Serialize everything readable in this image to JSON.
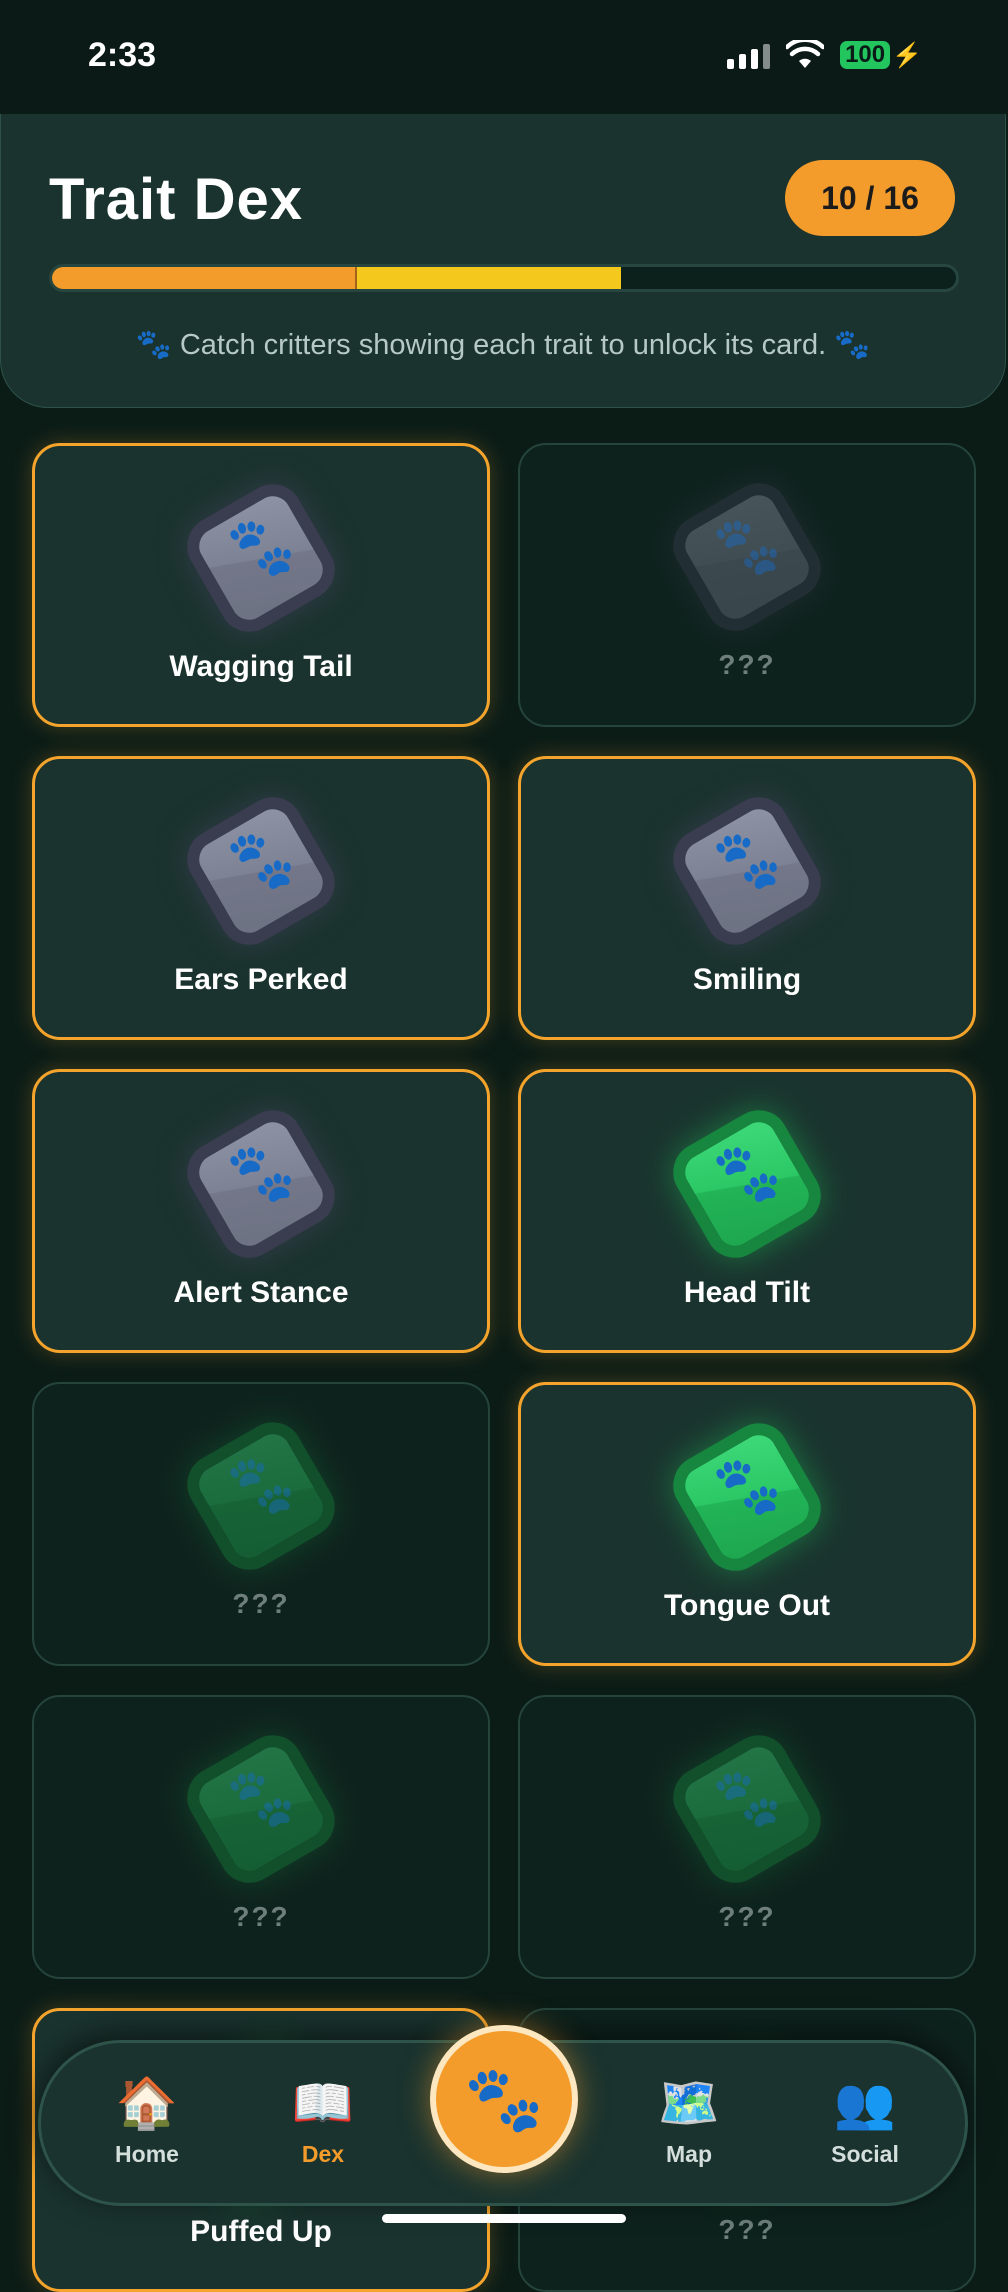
{
  "status": {
    "time": "2:33",
    "battery": "100"
  },
  "header": {
    "title": "Trait Dex",
    "count": "10 / 16",
    "progress_segments": [
      0.335,
      0.29
    ],
    "hint_text": "Catch critters showing each trait to unlock its card.",
    "hint_icon": "paw-icon"
  },
  "cards": [
    {
      "label": "Wagging Tail",
      "unlocked": true,
      "gem": "gray"
    },
    {
      "label": "???",
      "unlocked": false,
      "gem": "gray"
    },
    {
      "label": "Ears Perked",
      "unlocked": true,
      "gem": "gray"
    },
    {
      "label": "Smiling",
      "unlocked": true,
      "gem": "gray"
    },
    {
      "label": "Alert Stance",
      "unlocked": true,
      "gem": "gray"
    },
    {
      "label": "Head Tilt",
      "unlocked": true,
      "gem": "green"
    },
    {
      "label": "???",
      "unlocked": false,
      "gem": "green"
    },
    {
      "label": "Tongue Out",
      "unlocked": true,
      "gem": "green"
    },
    {
      "label": "???",
      "unlocked": false,
      "gem": "green"
    },
    {
      "label": "???",
      "unlocked": false,
      "gem": "green"
    },
    {
      "label": "Puffed Up",
      "unlocked": true,
      "gem": "green"
    },
    {
      "label": "???",
      "unlocked": false,
      "gem": "blue"
    }
  ],
  "nav": {
    "home": {
      "label": "Home",
      "icon": "house-icon"
    },
    "dex": {
      "label": "Dex",
      "icon": "book-icon"
    },
    "catch": {
      "icon": "paw-icon"
    },
    "map": {
      "label": "Map",
      "icon": "map-icon"
    },
    "social": {
      "label": "Social",
      "icon": "people-icon"
    }
  },
  "colors": {
    "accent": "#f39c2b",
    "progress_secondary": "#f4c81d",
    "gem_green": "#22c55e",
    "gem_gray": "#7d8294"
  }
}
